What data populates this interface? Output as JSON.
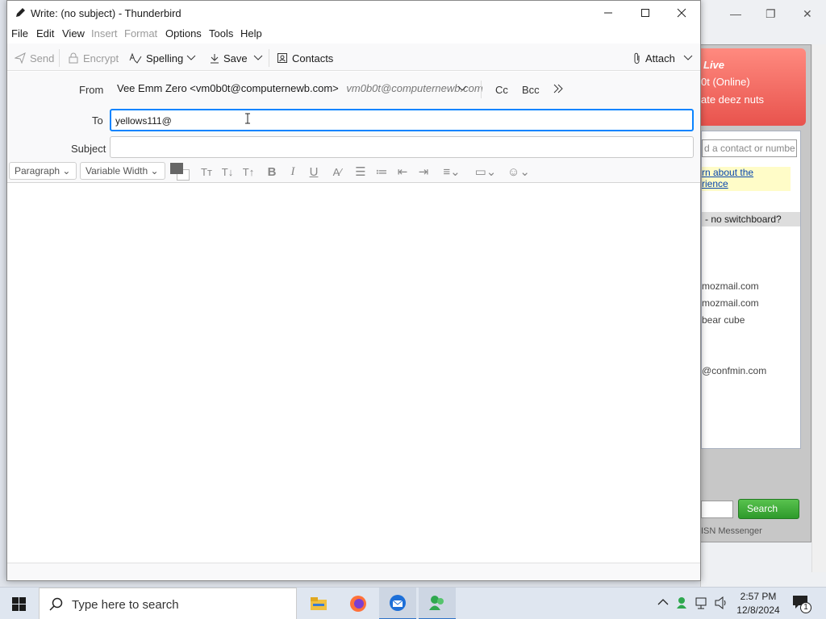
{
  "window": {
    "title": "Write: (no subject) - Thunderbird"
  },
  "menu": [
    "File",
    "Edit",
    "View",
    "Insert",
    "Format",
    "Options",
    "Tools",
    "Help"
  ],
  "menu_disabled": [
    "Insert",
    "Format"
  ],
  "toolbar": {
    "send": "Send",
    "encrypt": "Encrypt",
    "spelling": "Spelling",
    "save": "Save",
    "contacts": "Contacts",
    "attach": "Attach"
  },
  "header": {
    "from_label": "From",
    "from_value": "Vee Emm Zero <vm0b0t@computernewb.com>",
    "from_alias": "vm0b0t@computernewb.com",
    "cc": "Cc",
    "bcc": "Bcc",
    "to_label": "To",
    "to_value": "yellows111@",
    "subject_label": "Subject",
    "subject_value": ""
  },
  "format": {
    "paragraph": "Paragraph",
    "font": "Variable Width"
  },
  "background_app": {
    "status": "0t (Online)",
    "personal_message": "ate deez nuts",
    "brand": "Live",
    "search_placeholder": "d a contact or numbe",
    "info_line1": "rn about the",
    "info_line2": "rience",
    "group_header": "- no switchboard?",
    "contacts": [
      "mozmail.com",
      "mozmail.com",
      "bear cube",
      "@confmin.com"
    ],
    "search_button": "Search",
    "footer": "ISN Messenger"
  },
  "taskbar": {
    "search_placeholder": "Type here to search",
    "time": "2:57 PM",
    "date": "12/8/2024",
    "notification_count": "1"
  }
}
